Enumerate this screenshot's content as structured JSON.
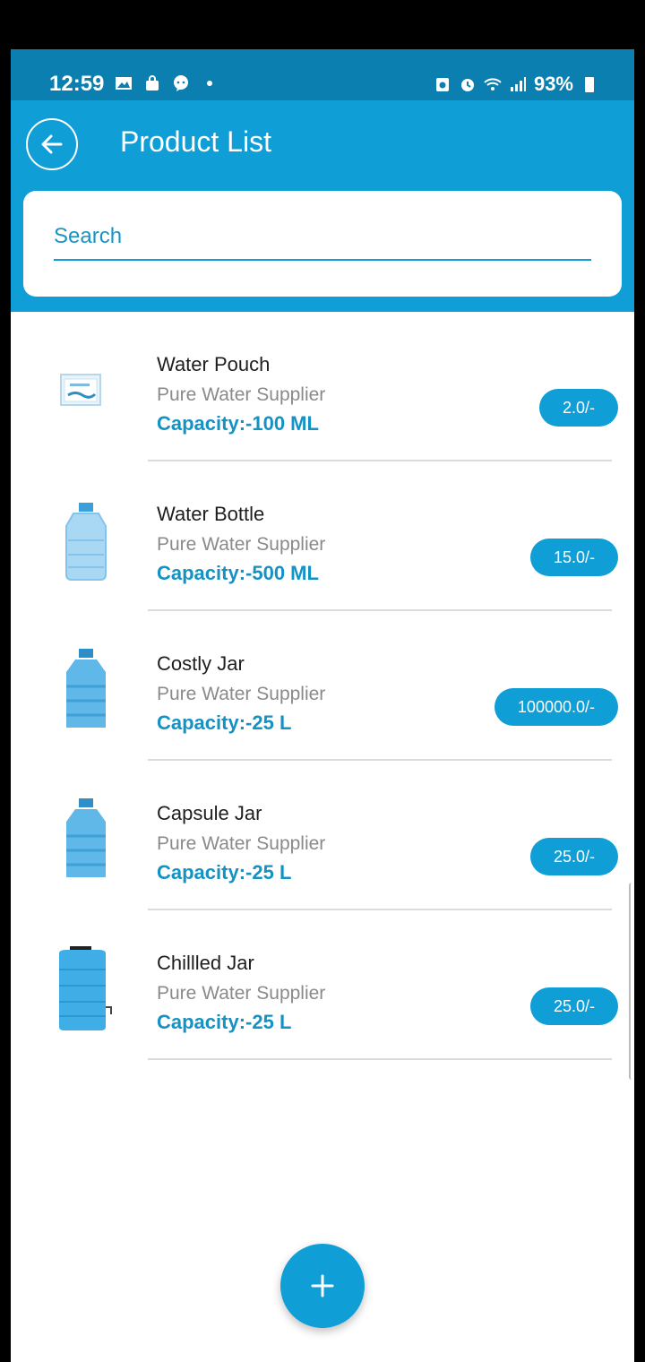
{
  "status_bar": {
    "time": "12:59",
    "battery": "93%"
  },
  "header": {
    "title": "Product List"
  },
  "search": {
    "placeholder": "Search"
  },
  "products": [
    {
      "name": "Water Pouch",
      "supplier": "Pure Water Supplier",
      "capacity": "Capacity:-100 ML",
      "price": "2.0/-",
      "icon": "water-pouch-icon"
    },
    {
      "name": "Water Bottle",
      "supplier": "Pure Water Supplier",
      "capacity": "Capacity:-500 ML",
      "price": "15.0/-",
      "icon": "water-bottle-icon"
    },
    {
      "name": "Costly Jar",
      "supplier": "Pure Water Supplier",
      "capacity": "Capacity:-25 L",
      "price": "100000.0/-",
      "icon": "water-jar-icon"
    },
    {
      "name": "Capsule Jar",
      "supplier": "Pure Water Supplier",
      "capacity": "Capacity:-25 L",
      "price": "25.0/-",
      "icon": "water-jar-icon"
    },
    {
      "name": "Chillled Jar",
      "supplier": "Pure Water Supplier",
      "capacity": "Capacity:-25 L",
      "price": "25.0/-",
      "icon": "water-dispenser-icon"
    }
  ],
  "colors": {
    "status_bar": "#0a7fb0",
    "primary": "#0f9ed6",
    "capacity_text": "#1592c4"
  }
}
